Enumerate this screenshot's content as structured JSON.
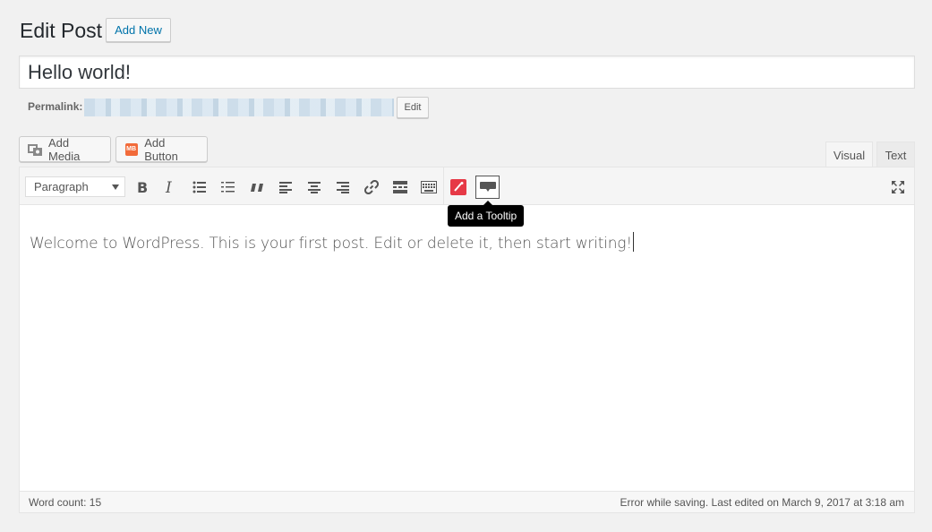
{
  "header": {
    "title": "Edit Post",
    "add_new_label": "Add New"
  },
  "post": {
    "title_value": "Hello world!",
    "permalink_label": "Permalink:",
    "permalink_edit_label": "Edit",
    "body_text": "Welcome to WordPress. This is your first post. Edit or delete it, then start writing!"
  },
  "media_buttons": {
    "add_media_label": "Add Media",
    "add_button_label": "Add Button",
    "mb_badge": "MB"
  },
  "tabs": {
    "visual_label": "Visual",
    "text_label": "Text",
    "active": "Visual"
  },
  "toolbar": {
    "format_selected": "Paragraph",
    "tooltip_text": "Add a Tooltip",
    "icons": [
      "bold-icon",
      "italic-icon",
      "bulleted-list-icon",
      "numbered-list-icon",
      "blockquote-icon",
      "align-left-icon",
      "align-center-icon",
      "align-right-icon",
      "link-icon",
      "read-more-icon",
      "toolbar-toggle-icon",
      "tooltip-plugin-icon",
      "add-tooltip-icon",
      "fullscreen-icon"
    ]
  },
  "status": {
    "word_count": "Word count: 15",
    "save_message": "Error while saving. Last edited on March 9, 2017 at 3:18 am"
  },
  "colors": {
    "link_blue": "#0073aa",
    "plugin_red": "#e63946",
    "mb_orange": "#f26b3a"
  }
}
